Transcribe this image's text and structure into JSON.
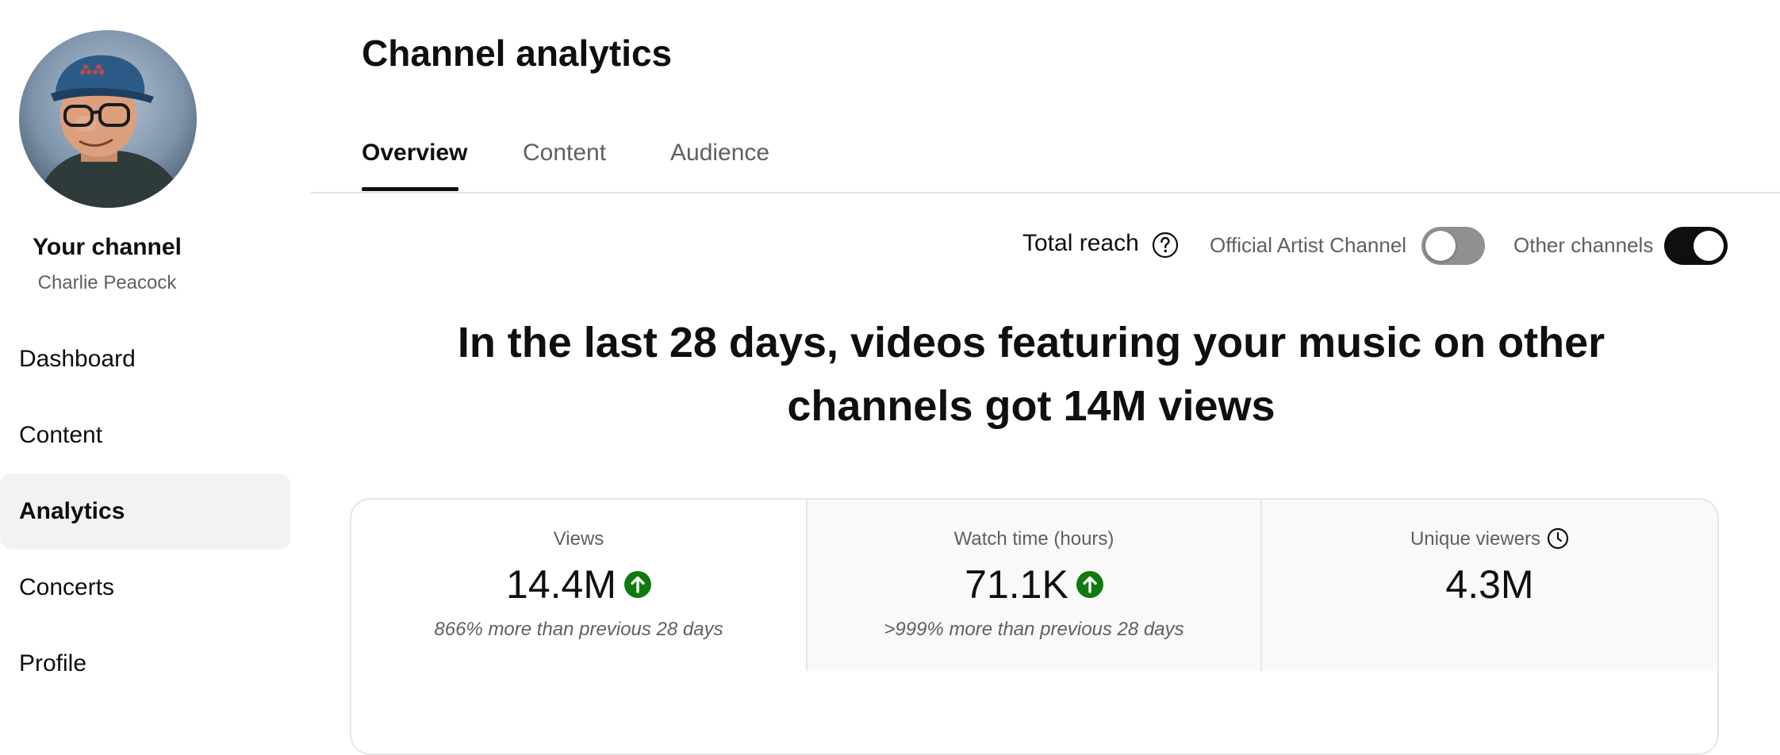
{
  "sidebar": {
    "channel_title": "Your channel",
    "channel_name": "Charlie Peacock",
    "nav": [
      "Dashboard",
      "Content",
      "Analytics",
      "Concerts",
      "Profile"
    ],
    "active_nav": "Analytics"
  },
  "header": {
    "title": "Channel analytics",
    "tabs": [
      "Overview",
      "Content",
      "Audience"
    ],
    "active_tab": "Overview"
  },
  "filters": {
    "total_reach_label": "Total reach",
    "help_icon": "help-icon",
    "official_artist_channel": {
      "label": "Official Artist Channel",
      "enabled": false
    },
    "other_channels": {
      "label": "Other channels",
      "enabled": true
    }
  },
  "headline": {
    "line1": "In the last 28 days, videos featuring your music on other",
    "line2": "channels got 14M views"
  },
  "metrics": [
    {
      "label": "Views",
      "value": "14.4M",
      "trend_icon": "arrow-up-circle-icon",
      "change": "866% more than previous 28 days"
    },
    {
      "label": "Watch time (hours)",
      "value": "71.1K",
      "trend_icon": "arrow-up-circle-icon",
      "change": ">999% more than previous 28 days"
    },
    {
      "label": "Unique viewers",
      "value": "4.3M",
      "label_icon": "clock-icon"
    }
  ],
  "colors": {
    "trend_up": "#0f7a0f",
    "toggle_on": "#0f0f0f",
    "toggle_off": "#909090",
    "active_bg": "#f2f2f2"
  }
}
